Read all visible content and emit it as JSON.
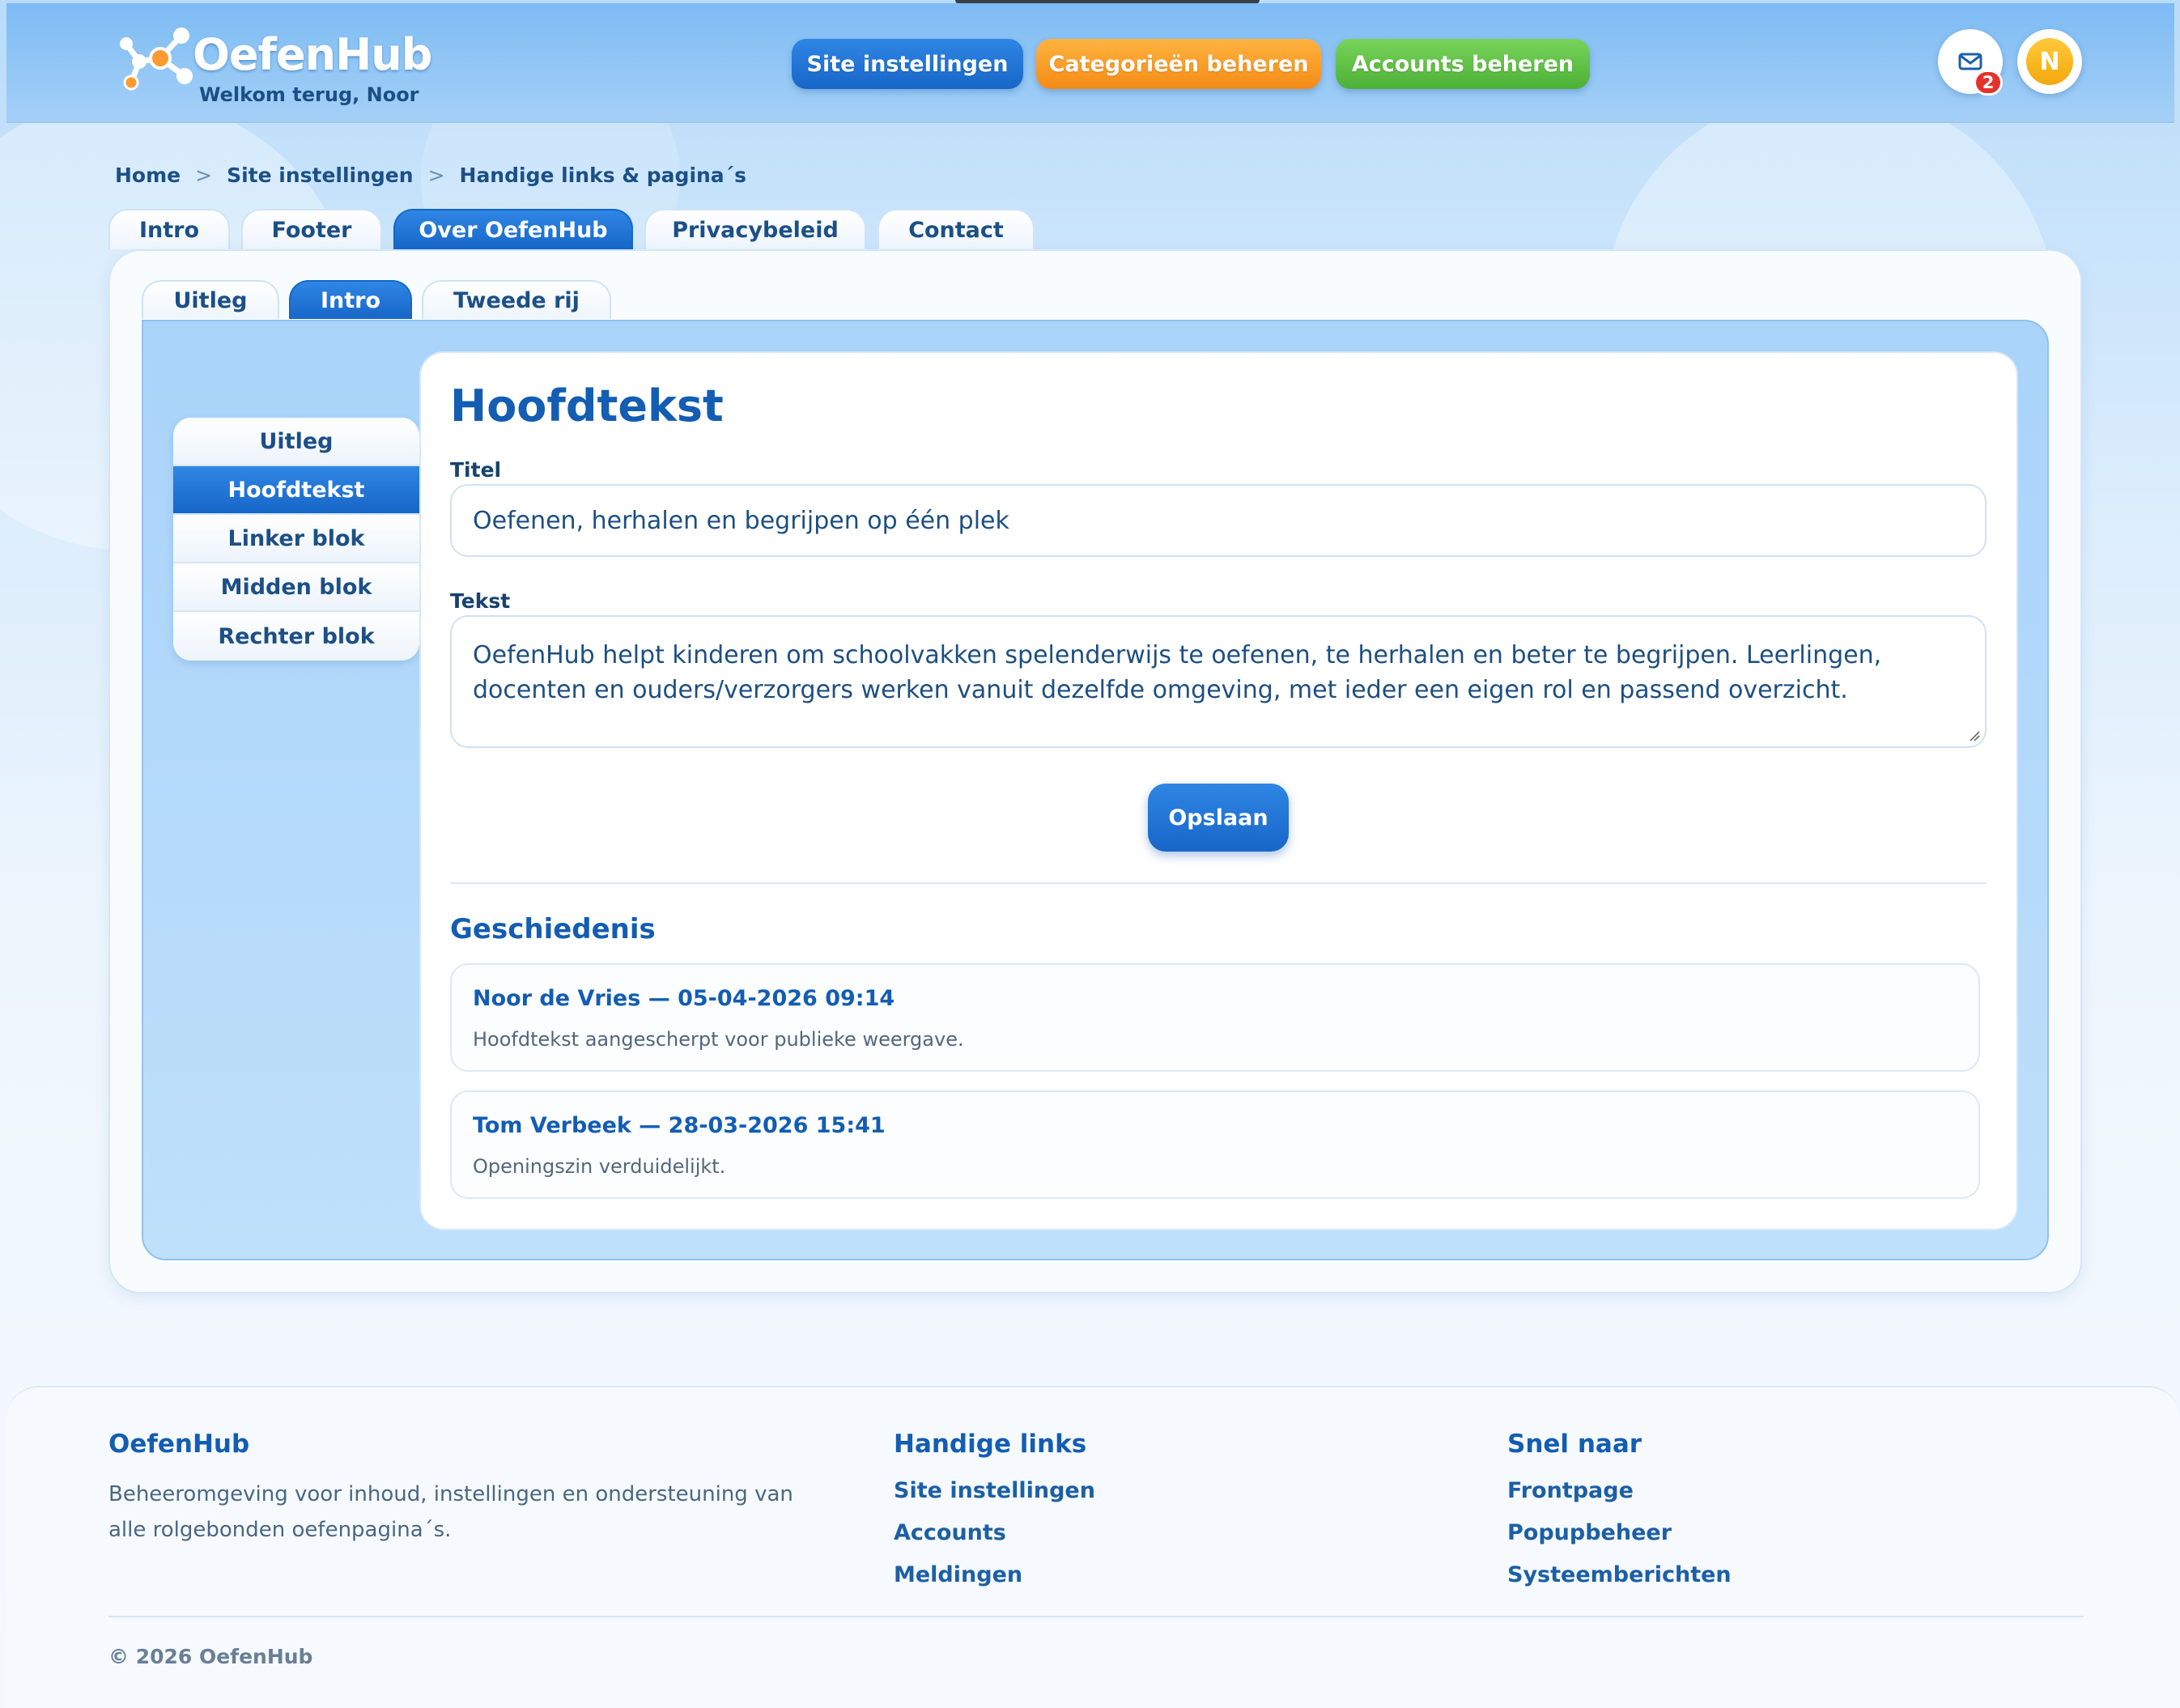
{
  "header": {
    "brand": "OefenHub",
    "welcome": "Welkom terug, Noor",
    "nav": {
      "site_settings": "Site instellingen",
      "categories": "Categorieën beheren",
      "accounts": "Accounts beheren"
    },
    "notifications_count": "2",
    "avatar_initial": "N",
    "colors": {
      "blue": "#1766c8",
      "orange": "#f58b16",
      "green": "#4db036"
    }
  },
  "breadcrumb": {
    "items": [
      "Home",
      "Site instellingen",
      "Handige links & pagina´s"
    ],
    "separator": ">"
  },
  "top_tabs": [
    "Intro",
    "Footer",
    "Over OefenHub",
    "Privacybeleid",
    "Contact"
  ],
  "top_tabs_active": "Over OefenHub",
  "sub_tabs": [
    "Uitleg",
    "Intro",
    "Tweede rij"
  ],
  "sub_tabs_active": "Intro",
  "side_menu": [
    "Uitleg",
    "Hoofdtekst",
    "Linker blok",
    "Midden blok",
    "Rechter blok"
  ],
  "side_menu_active": "Hoofdtekst",
  "editor": {
    "heading": "Hoofdtekst",
    "title_label": "Titel",
    "title_value": "Oefenen, herhalen en begrijpen op één plek",
    "text_label": "Tekst",
    "text_value": "OefenHub helpt kinderen om schoolvakken spelenderwijs te oefenen, te herhalen en beter te begrijpen. Leerlingen, docenten en ouders/verzorgers werken vanuit dezelfde omgeving, met ieder een eigen rol en passend overzicht.",
    "save_label": "Opslaan"
  },
  "history": {
    "heading": "Geschiedenis",
    "entries": [
      {
        "author": "Noor de Vries — 05-04-2026 09:14",
        "note": "Hoofdtekst aangescherpt voor publieke weergave."
      },
      {
        "author": "Tom Verbeek — 28-03-2026 15:41",
        "note": "Openingszin verduidelijkt."
      }
    ]
  },
  "footer": {
    "col1_title": "OefenHub",
    "col1_desc": "Beheeromgeving voor inhoud, instellingen en ondersteuning van alle rolgebonden oefenpagina´s.",
    "col2_title": "Handige links",
    "col2_links": [
      "Site instellingen",
      "Accounts",
      "Meldingen"
    ],
    "col3_title": "Snel naar",
    "col3_links": [
      "Frontpage",
      "Popupbeheer",
      "Systeemberichten"
    ],
    "copyright": "© 2026 OefenHub"
  }
}
